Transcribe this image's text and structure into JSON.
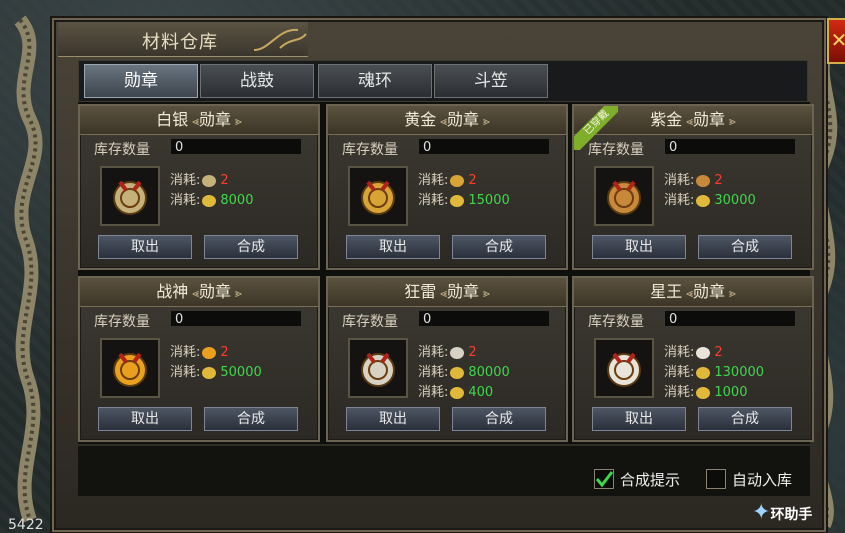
{
  "window": {
    "title": "材料仓库",
    "close_symbol": "✕"
  },
  "tabs": [
    {
      "label": "勋章",
      "active": true
    },
    {
      "label": "战鼓",
      "active": false
    },
    {
      "label": "魂环",
      "active": false
    },
    {
      "label": "斗笠",
      "active": false
    }
  ],
  "panels": [
    {
      "name": "白银",
      "type": "勋章",
      "stock_label": "库存数量",
      "stock": "0",
      "costs": [
        {
          "label": "消耗:",
          "icon": "silver-medal-icon",
          "value": "2",
          "color": "red"
        },
        {
          "label": "消耗:",
          "icon": "gold-ingot-icon",
          "value": "8000",
          "color": "green"
        }
      ],
      "take_label": "取出",
      "merge_label": "合成",
      "ribbon": ""
    },
    {
      "name": "黄金",
      "type": "勋章",
      "stock_label": "库存数量",
      "stock": "0",
      "costs": [
        {
          "label": "消耗:",
          "icon": "gold-medal-icon",
          "value": "2",
          "color": "red"
        },
        {
          "label": "消耗:",
          "icon": "gold-ingot-icon",
          "value": "15000",
          "color": "green"
        }
      ],
      "take_label": "取出",
      "merge_label": "合成",
      "ribbon": ""
    },
    {
      "name": "紫金",
      "type": "勋章",
      "stock_label": "库存数量",
      "stock": "0",
      "costs": [
        {
          "label": "消耗:",
          "icon": "purple-gold-medal-icon",
          "value": "2",
          "color": "red"
        },
        {
          "label": "消耗:",
          "icon": "gold-ingot-icon",
          "value": "30000",
          "color": "green"
        }
      ],
      "take_label": "取出",
      "merge_label": "合成",
      "ribbon": "已穿戴"
    },
    {
      "name": "战神",
      "type": "勋章",
      "stock_label": "库存数量",
      "stock": "0",
      "costs": [
        {
          "label": "消耗:",
          "icon": "war-god-medal-icon",
          "value": "2",
          "color": "red"
        },
        {
          "label": "消耗:",
          "icon": "gold-ingot-icon",
          "value": "50000",
          "color": "green"
        }
      ],
      "take_label": "取出",
      "merge_label": "合成",
      "ribbon": ""
    },
    {
      "name": "狂雷",
      "type": "勋章",
      "stock_label": "库存数量",
      "stock": "0",
      "costs": [
        {
          "label": "消耗:",
          "icon": "thunder-medal-icon",
          "value": "2",
          "color": "red"
        },
        {
          "label": "消耗:",
          "icon": "gold-ingot-icon",
          "value": "80000",
          "color": "green"
        },
        {
          "label": "消耗:",
          "icon": "material-icon",
          "value": "400",
          "color": "green"
        }
      ],
      "take_label": "取出",
      "merge_label": "合成",
      "ribbon": ""
    },
    {
      "name": "星王",
      "type": "勋章",
      "stock_label": "库存数量",
      "stock": "0",
      "costs": [
        {
          "label": "消耗:",
          "icon": "star-king-medal-icon",
          "value": "2",
          "color": "red"
        },
        {
          "label": "消耗:",
          "icon": "gold-ingot-icon",
          "value": "130000",
          "color": "green"
        },
        {
          "label": "消耗:",
          "icon": "material-icon",
          "value": "1000",
          "color": "green"
        }
      ],
      "take_label": "取出",
      "merge_label": "合成",
      "ribbon": ""
    }
  ],
  "options": {
    "merge_hint_label": "合成提示",
    "merge_hint_checked": true,
    "auto_store_label": "自动入库",
    "auto_store_checked": false
  },
  "corner_number": "5422",
  "watermark": "环助手"
}
